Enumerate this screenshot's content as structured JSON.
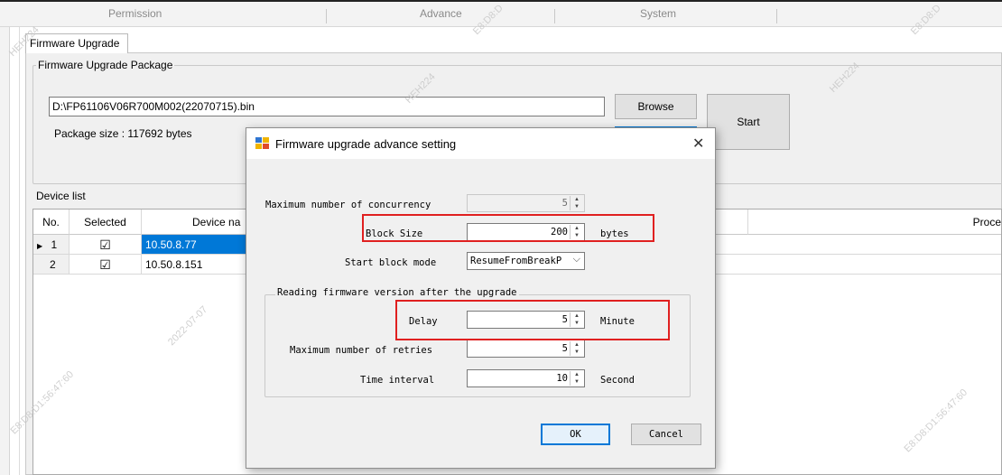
{
  "top_tabs": [
    "Permission",
    "Advance",
    "System"
  ],
  "upgrade_tab": "Firmware Upgrade",
  "package_group": {
    "label": "Firmware Upgrade Package",
    "path": "D:\\FP61106V06R700M002(22070715).bin",
    "size_text": "Package size : 117692  bytes",
    "browse": "Browse",
    "start": "Start"
  },
  "device_list": {
    "label": "Device list",
    "columns": [
      "No.",
      "Selected",
      "Device na",
      "Proce"
    ],
    "rows": [
      {
        "marker": "▶",
        "no": "1",
        "checked": "☑",
        "device": "10.50.8.77"
      },
      {
        "marker": "",
        "no": "2",
        "checked": "☑",
        "device": "10.50.8.151"
      }
    ]
  },
  "dialog": {
    "title": "Firmware upgrade advance setting",
    "close": "✕",
    "max_concurrency_label": "Maximum number of concurrency",
    "max_concurrency_value": "5",
    "block_size_label": "Block Size",
    "block_size_value": "200",
    "block_size_unit": "bytes",
    "start_block_label": "Start block mode",
    "start_block_value": "ResumeFromBreakP",
    "reading_group_label": "Reading firmware version after the upgrade",
    "delay_label": "Delay",
    "delay_value": "5",
    "delay_unit": "Minute",
    "retries_label": "Maximum number of retries",
    "retries_value": "5",
    "interval_label": "Time interval",
    "interval_value": "10",
    "interval_unit": "Second",
    "ok": "OK",
    "cancel": "Cancel"
  },
  "watermarks": [
    "HEH224",
    "E8:D8:D",
    "2022-07-07",
    "E8:D8:D1:56:47:60",
    "HEH224"
  ]
}
